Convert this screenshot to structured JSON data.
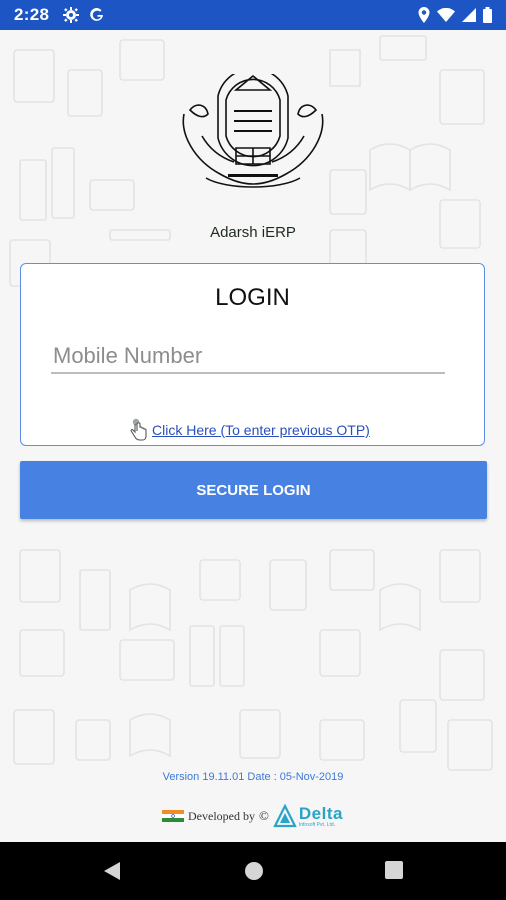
{
  "status_bar": {
    "time": "2:28",
    "left_icons": [
      "gear-icon",
      "google-g-icon"
    ],
    "right_icons": [
      "location-icon",
      "wifi-icon",
      "signal-icon",
      "battery-icon"
    ]
  },
  "app": {
    "name": "Adarsh iERP"
  },
  "login_card": {
    "title": "LOGIN",
    "mobile_placeholder": "Mobile Number",
    "mobile_value": "",
    "otp_link": "Click Here (To enter previous OTP)"
  },
  "secure_login_label": "SECURE LOGIN",
  "footer": {
    "version": "Version 19.11.01 Date : 05-Nov-2019",
    "developed_by": "Developed by",
    "copyright_symbol": "©",
    "company_name": "Delta",
    "company_sub": "Infosoft Pvt. Ltd."
  },
  "colors": {
    "status_bar": "#1d56c4",
    "accent": "#4782e3",
    "link": "#2a4fbd",
    "card_border": "#5e8ee6"
  },
  "nav_bar": {
    "buttons": [
      "back-icon",
      "home-icon",
      "recents-icon"
    ]
  }
}
